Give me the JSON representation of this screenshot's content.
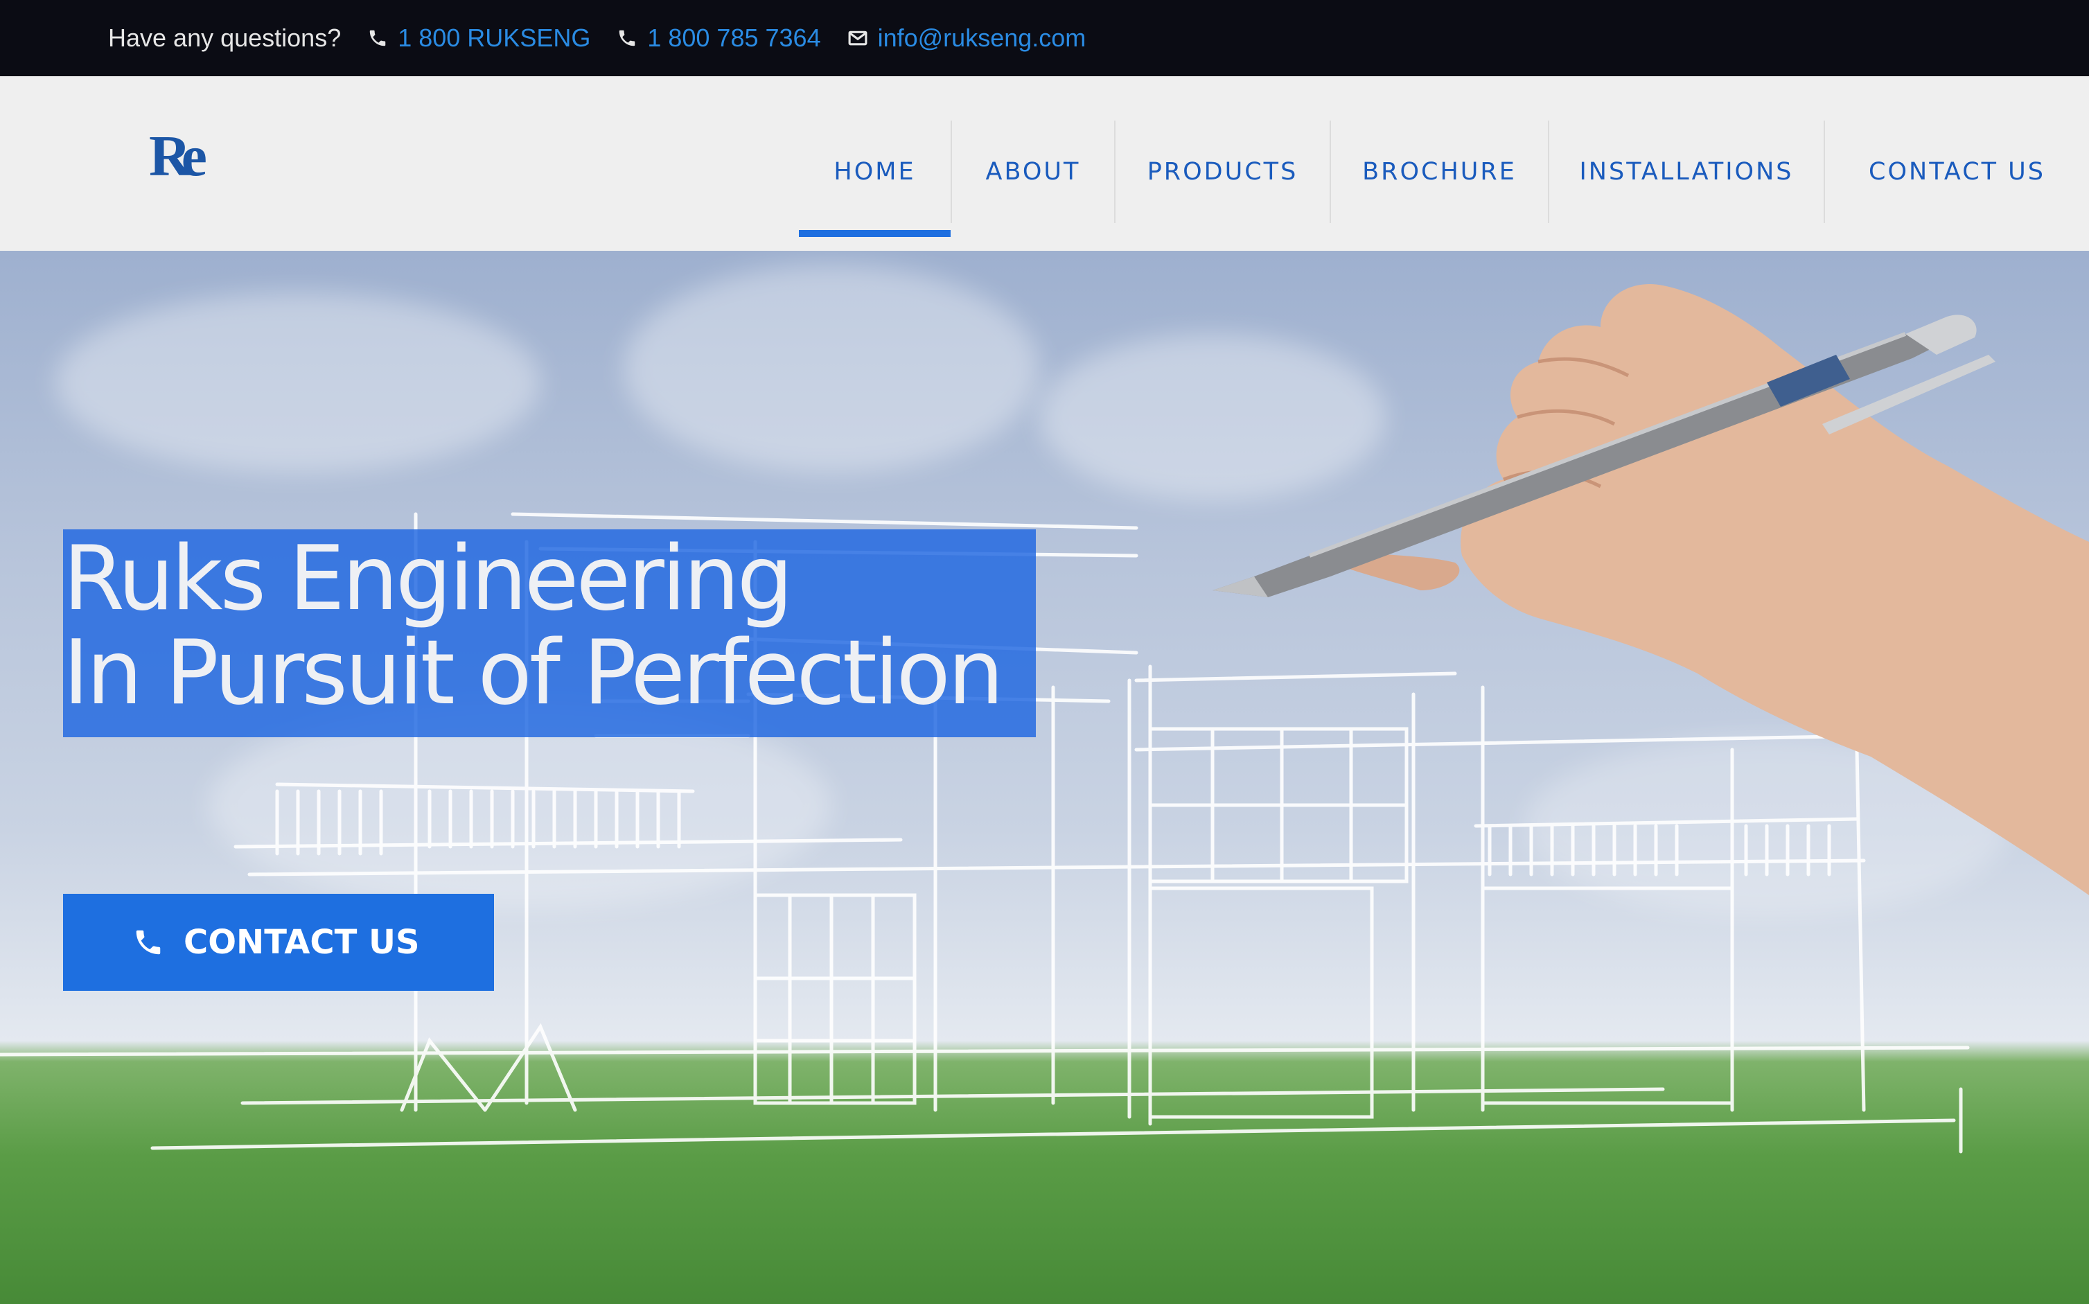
{
  "topbar": {
    "question": "Have any questions?",
    "phone1": "1 800 RUKSENG",
    "phone2": "1 800 785 7364",
    "email": "info@rukseng.com"
  },
  "header": {
    "logo_text": "Re",
    "nav": [
      {
        "label": "HOME",
        "active": true
      },
      {
        "label": "ABOUT"
      },
      {
        "label": "PRODUCTS"
      },
      {
        "label": "BROCHURE"
      },
      {
        "label": "INSTALLATIONS"
      },
      {
        "label": "CONTACT US"
      }
    ]
  },
  "hero": {
    "headline_line1": "Ruks Engineering",
    "headline_line2": "In Pursuit of Perfection",
    "cta_label": "CONTACT US"
  },
  "colors": {
    "accent": "#1e6fe0",
    "nav_text": "#1a5bbd",
    "topbar_bg": "#0b0c14",
    "link": "#2a8be3",
    "logo": "#1c56a6"
  },
  "icons": [
    "phone-icon",
    "phone-icon",
    "mail-icon",
    "phone-icon"
  ]
}
